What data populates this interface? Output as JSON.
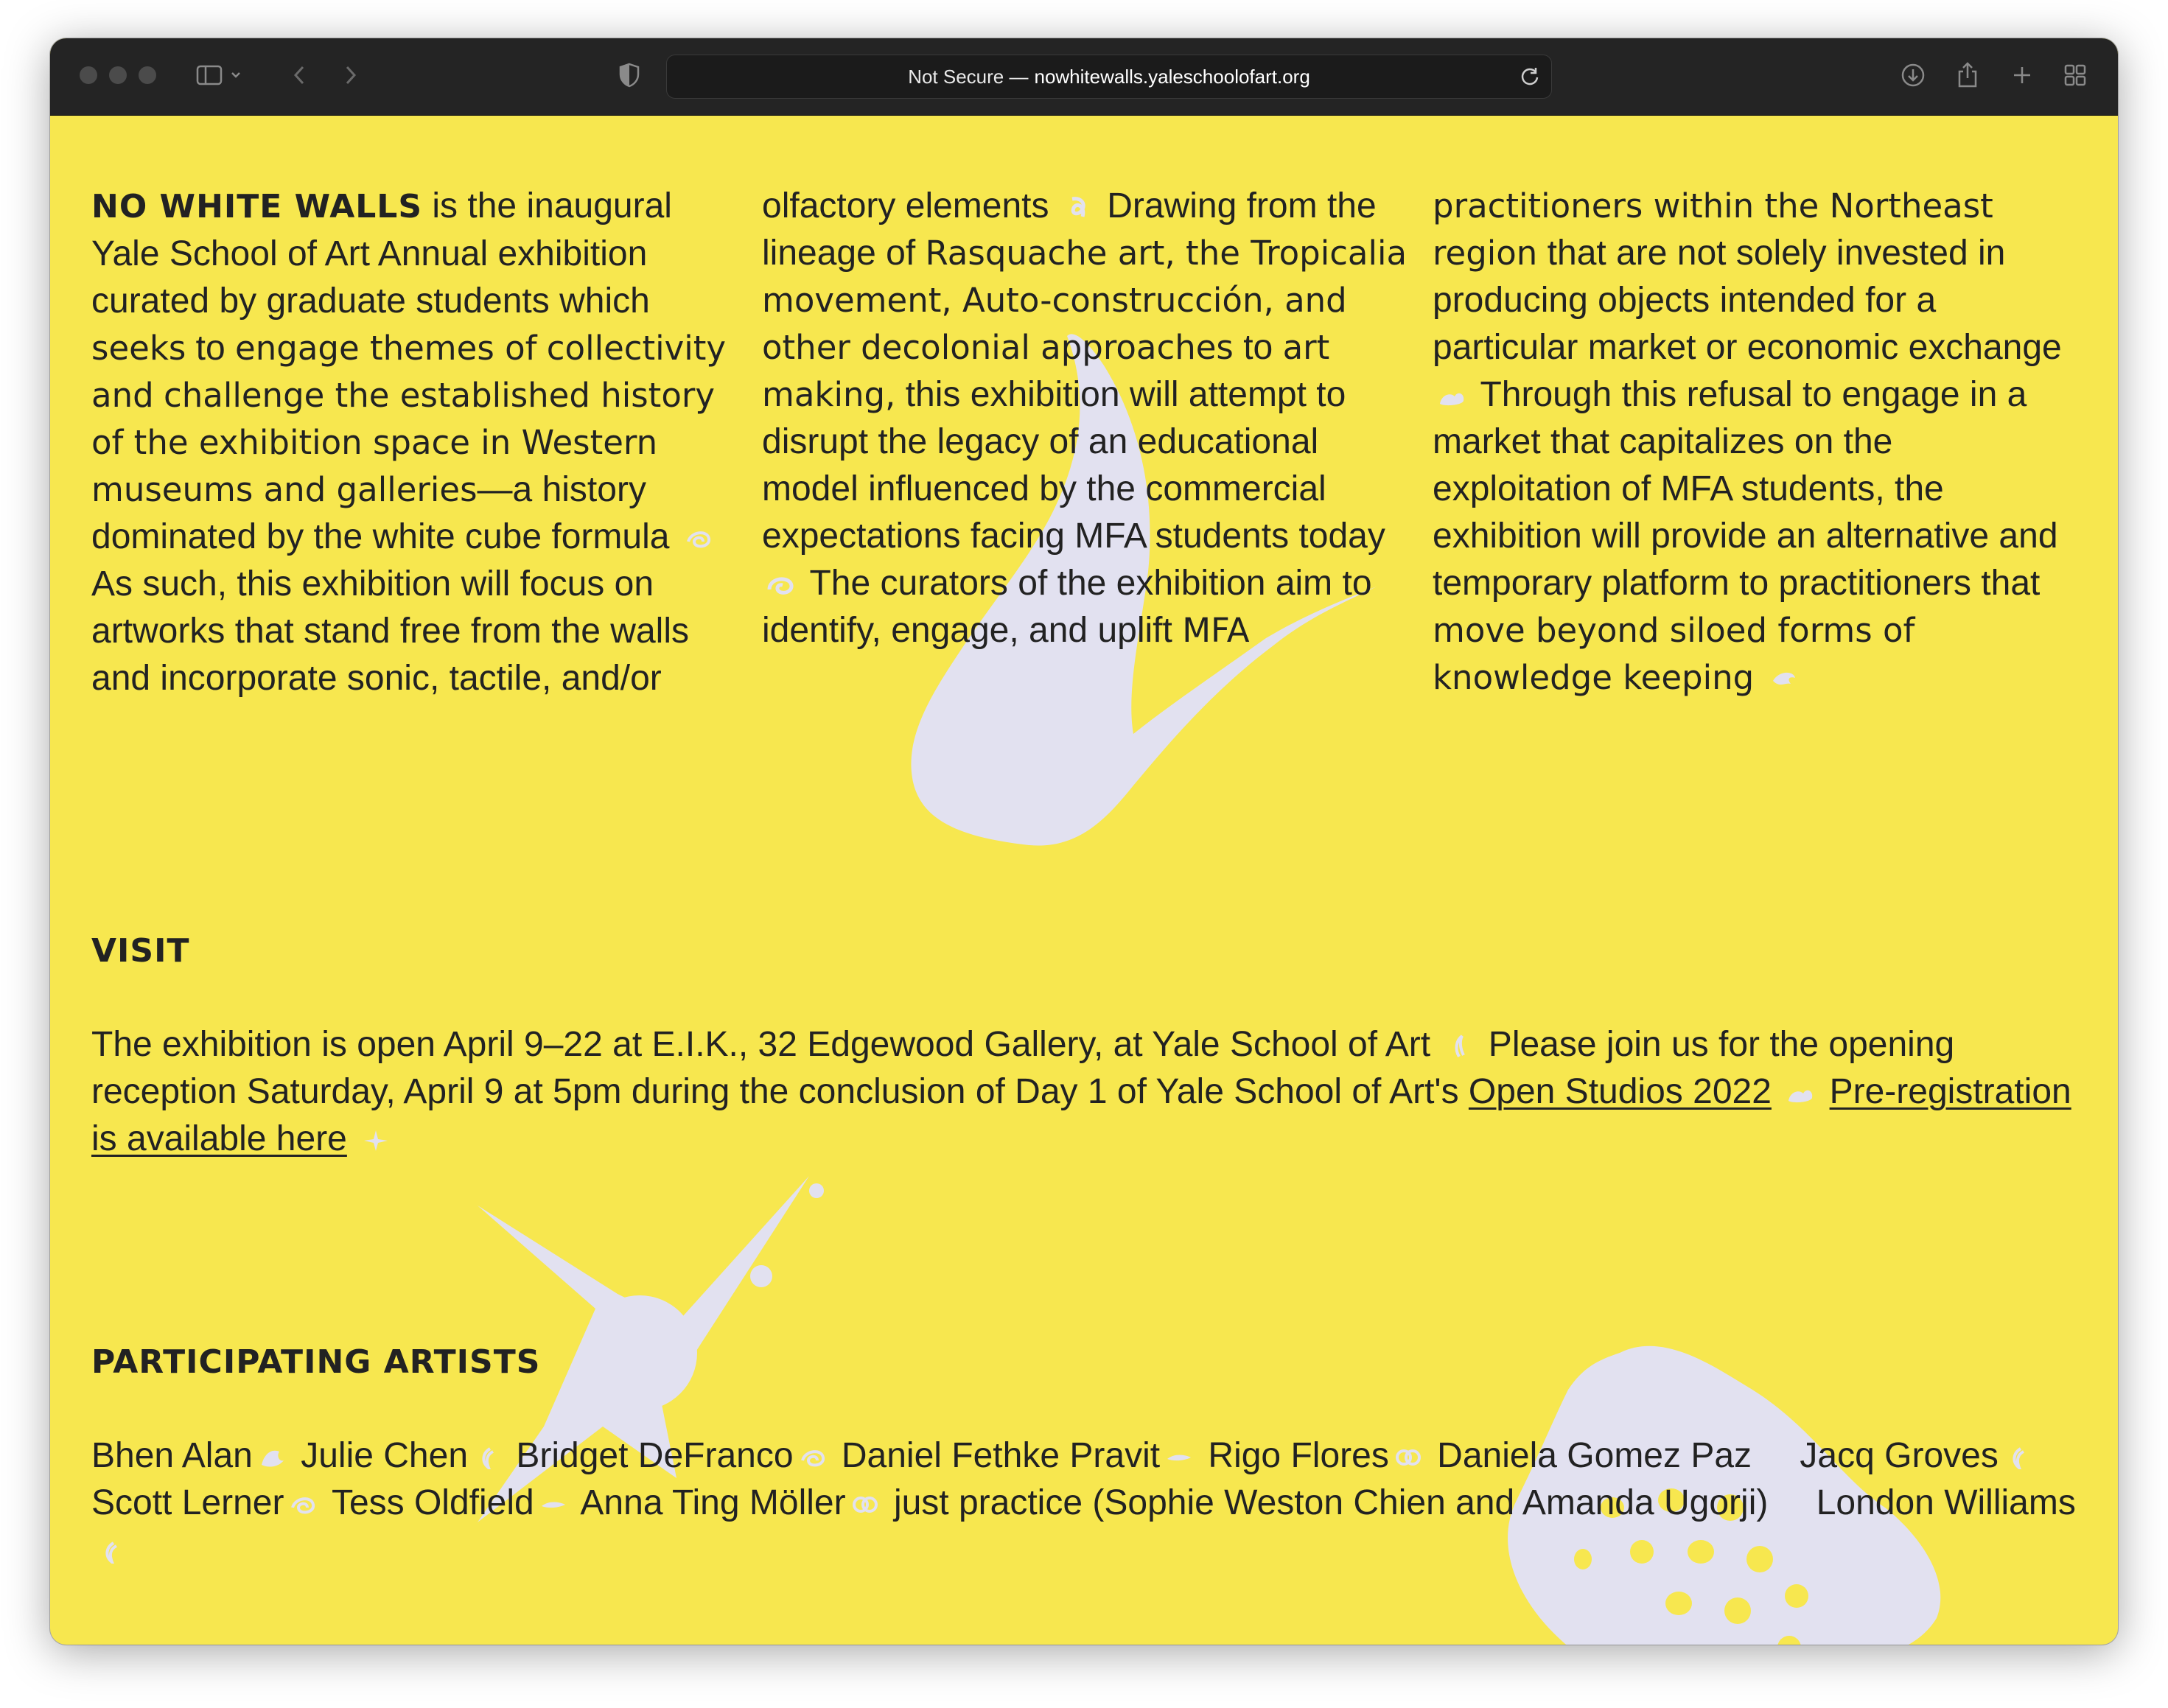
{
  "browser": {
    "url_prefix": "Not Secure —",
    "url_host": "nowhitewalls.yaleschoolofart.org",
    "colors": {
      "toolbar": "#242424",
      "page_bg": "#f7e74f",
      "text": "#222222",
      "blob": "#e2e1f0"
    }
  },
  "intro": {
    "title": "NO WHITE WALLS",
    "c1_a": "is the inaugural Yale School of Art Annual exhibition curated by graduate students which",
    "c1_g1": "seeks",
    "c1_b": "to",
    "c1_g2": "engage themes of",
    "c1_c": "collectivity and",
    "c1_g3": "challenge the established history of the exhibition space in Western museums and galleries",
    "c1_d": "—a history dominated by the white cube formula",
    "c1_e": "As such, this exhibition will focus on artworks that stand free from the walls and incorporate sonic, tactile, and/or",
    "c2_a": "olfactory elements",
    "c2_b": "Drawing from the lineage of",
    "c2_g1": "Rasquache art, the Tropicalia movement, Auto-construcción, and other decolonial approaches",
    "c2_c": "to",
    "c2_g2": "art making,",
    "c2_d": "this exhibition will attempt to disrupt the legacy of an educational model influenced by the commercial expectations facing MFA students today",
    "c2_e": "The curators of the exhibition aim to identify, engage, and uplift",
    "c2_g3": "MFA",
    "c3_g1": "practitioners within the Northeast region",
    "c3_a": "that are not solely invested in producing objects intended for a particular market or economic exchange",
    "c3_b": "Through this refusal to engage in a market that capitalizes on the exploitation of MFA students, the exhibition will provide an alternative and temporary platform to practitioners that",
    "c3_g2": "move beyond siloed forms of knowledge keeping"
  },
  "visit": {
    "heading": "VISIT",
    "text_a": "The exhibition is open April 9–22 at E.I.K., 32 Edgewood Gallery, at Yale School of Art",
    "text_b": "Please join us for the opening reception Saturday, April 9 at 5pm during the conclusion of Day 1 of Yale School of Art's",
    "link_open_studios": "Open Studios 2022",
    "link_preregistration": "Pre-registration is available here"
  },
  "artists": {
    "heading": "PARTICIPATING ARTISTS",
    "names": [
      "Bhen Alan",
      "Julie Chen",
      "Bridget DeFranco",
      "Daniel Fethke Pravit",
      "Rigo Flores",
      "Daniela Gomez Paz",
      "Jacq Groves",
      "Scott Lerner",
      "Tess Oldfield",
      "Anna Ting Möller",
      "just practice (Sophie Weston Chien and Amanda Ugorji)",
      "London Williams"
    ]
  }
}
